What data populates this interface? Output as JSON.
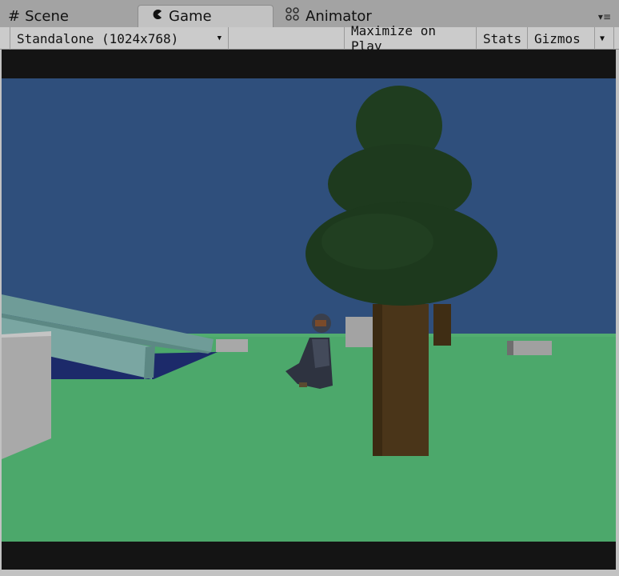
{
  "tabs": [
    {
      "label": "Scene",
      "icon": "grid-icon"
    },
    {
      "label": "Game",
      "icon": "pacman-icon"
    },
    {
      "label": "Animator",
      "icon": "animator-icon"
    }
  ],
  "toolbar": {
    "resolution": "Standalone (1024x768)",
    "maximize_on_play": "Maximize on Play",
    "stats": "Stats",
    "gizmos": "Gizmos"
  },
  "colors": {
    "sky": "#2f4f7c",
    "ground": "#4ca86b",
    "foliage": "#1f3d1f",
    "trunk": "#4a3519",
    "editor_bg": "#c2c2c2"
  }
}
